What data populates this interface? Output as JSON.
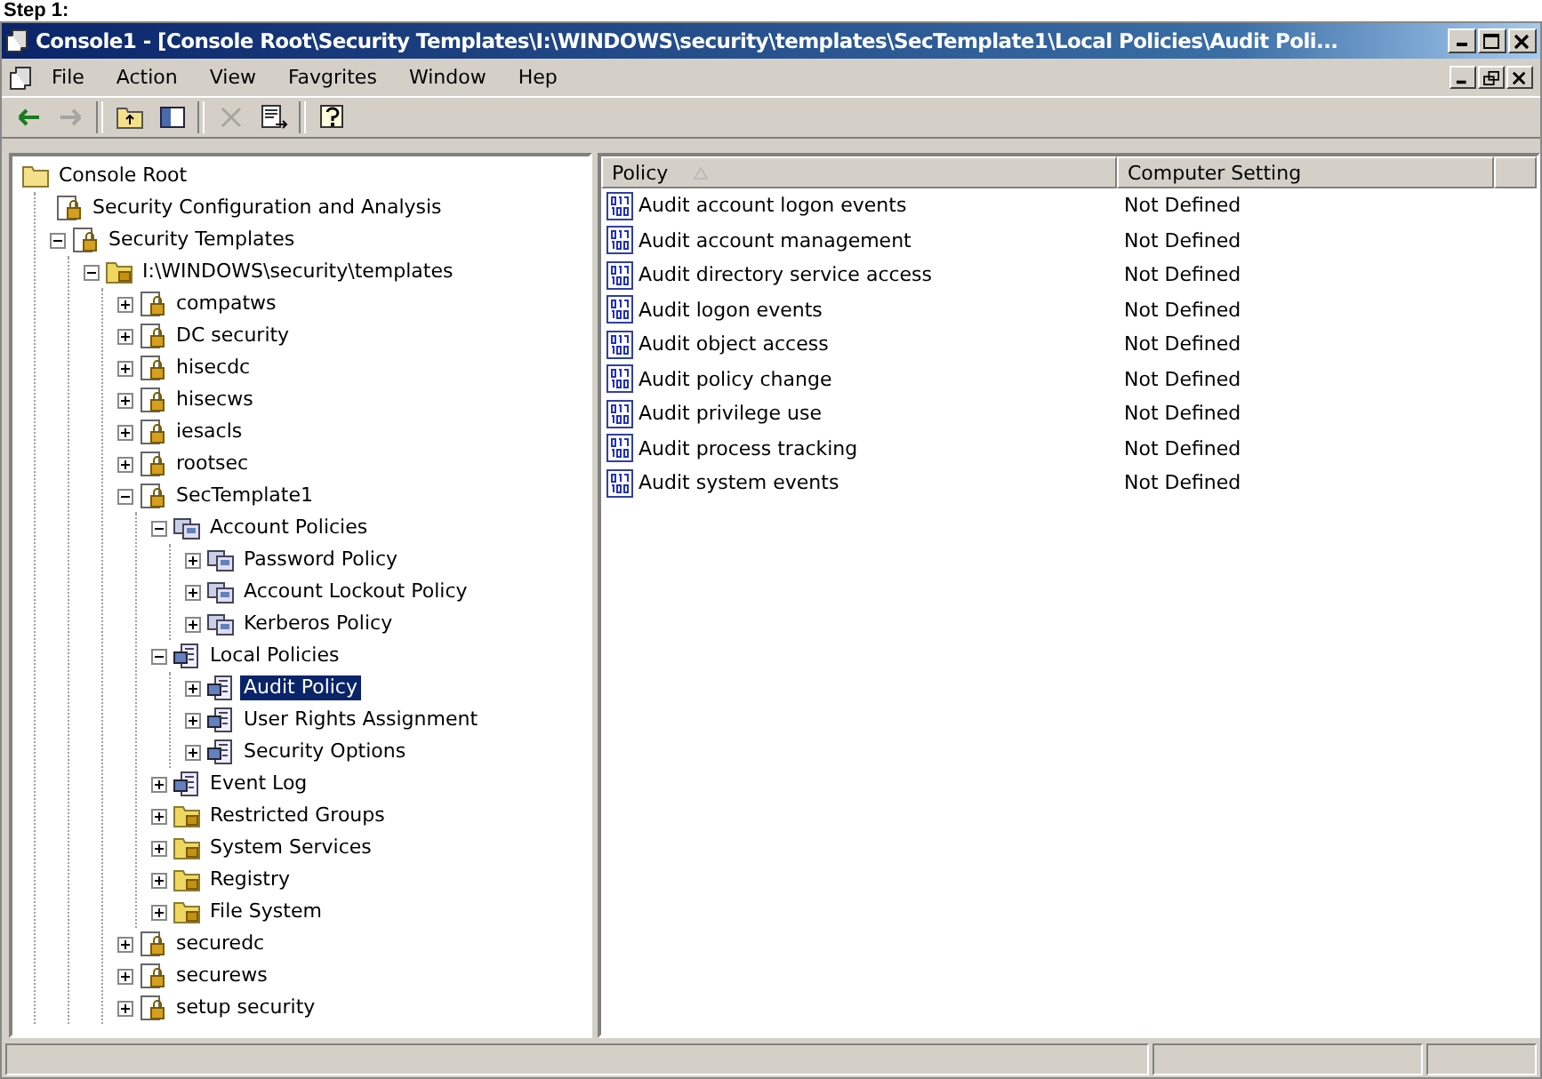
{
  "caption": "Step 1:",
  "window": {
    "title": "Console1 - [Console Root\\Security Templates\\I:\\WINDOWS\\security\\templates\\SecTemplate1\\Local Policies\\Audit Poli..."
  },
  "menu": [
    "File",
    "Action",
    "View",
    "Favgrites",
    "Window",
    "Hep"
  ],
  "toolbar": [
    {
      "kind": "back",
      "disabled": false
    },
    {
      "kind": "forward",
      "disabled": true
    },
    {
      "kind": "up",
      "disabled": false
    },
    {
      "kind": "tree",
      "disabled": false
    },
    {
      "kind": "delete",
      "disabled": true
    },
    {
      "kind": "export",
      "disabled": false
    },
    {
      "kind": "help",
      "disabled": false
    }
  ],
  "tree": [
    {
      "label": "Console Root",
      "kind": "folder",
      "selected": false,
      "children": [
        {
          "label": "Security Configuration and Analysis",
          "kind": "snapin",
          "selected": false
        },
        {
          "label": "Security Templates",
          "kind": "snapin",
          "selected": false,
          "expanded": true,
          "children": [
            {
              "label": "I:\\WINDOWS\\security\\templates",
              "kind": "store",
              "selected": false,
              "expanded": true,
              "children": [
                {
                  "label": "compatws",
                  "kind": "template",
                  "selected": false,
                  "expanded": false
                },
                {
                  "label": "DC security",
                  "kind": "template",
                  "selected": false,
                  "expanded": false
                },
                {
                  "label": "hisecdc",
                  "kind": "template",
                  "selected": false,
                  "expanded": false
                },
                {
                  "label": "hisecws",
                  "kind": "template",
                  "selected": false,
                  "expanded": false
                },
                {
                  "label": "iesacls",
                  "kind": "template",
                  "selected": false,
                  "expanded": false
                },
                {
                  "label": "rootsec",
                  "kind": "template",
                  "selected": false,
                  "expanded": false
                },
                {
                  "label": "SecTemplate1",
                  "kind": "template",
                  "selected": false,
                  "expanded": true,
                  "children": [
                    {
                      "label": "Account Policies",
                      "kind": "policy",
                      "selected": false,
                      "expanded": true,
                      "children": [
                        {
                          "label": "Password Policy",
                          "kind": "policy",
                          "selected": false,
                          "expanded": false
                        },
                        {
                          "label": "Account Lockout Policy",
                          "kind": "policy",
                          "selected": false,
                          "expanded": false
                        },
                        {
                          "label": "Kerberos Policy",
                          "kind": "policy",
                          "selected": false,
                          "expanded": false
                        }
                      ]
                    },
                    {
                      "label": "Local Policies",
                      "kind": "local",
                      "selected": false,
                      "expanded": true,
                      "children": [
                        {
                          "label": "Audit Policy",
                          "kind": "local",
                          "selected": true,
                          "expanded": false
                        },
                        {
                          "label": "User Rights Assignment",
                          "kind": "local",
                          "selected": false,
                          "expanded": false
                        },
                        {
                          "label": "Security Options",
                          "kind": "local",
                          "selected": false,
                          "expanded": false
                        }
                      ]
                    },
                    {
                      "label": "Event Log",
                      "kind": "local",
                      "selected": false,
                      "expanded": false
                    },
                    {
                      "label": "Restricted Groups",
                      "kind": "store",
                      "selected": false,
                      "expanded": false
                    },
                    {
                      "label": "System Services",
                      "kind": "store",
                      "selected": false,
                      "expanded": false
                    },
                    {
                      "label": "Registry",
                      "kind": "store",
                      "selected": false,
                      "expanded": false
                    },
                    {
                      "label": "File System",
                      "kind": "store",
                      "selected": false,
                      "expanded": false
                    }
                  ]
                },
                {
                  "label": "securedc",
                  "kind": "template",
                  "selected": false,
                  "expanded": false
                },
                {
                  "label": "securews",
                  "kind": "template",
                  "selected": false,
                  "expanded": false
                },
                {
                  "label": "setup security",
                  "kind": "template",
                  "selected": false,
                  "expanded": false
                }
              ]
            }
          ]
        }
      ]
    }
  ],
  "list": {
    "columns": [
      "Policy",
      "Computer Setting"
    ],
    "rows": [
      {
        "policy": "Audit account logon events",
        "setting": "Not Defined"
      },
      {
        "policy": "Audit account management",
        "setting": "Not Defined"
      },
      {
        "policy": "Audit directory service access",
        "setting": "Not Defined"
      },
      {
        "policy": "Audit logon events",
        "setting": "Not Defined"
      },
      {
        "policy": "Audit object access",
        "setting": "Not Defined"
      },
      {
        "policy": "Audit policy change",
        "setting": "Not Defined"
      },
      {
        "policy": "Audit privilege use",
        "setting": "Not Defined"
      },
      {
        "policy": "Audit process tracking",
        "setting": "Not Defined"
      },
      {
        "policy": "Audit system events",
        "setting": "Not Defined"
      }
    ]
  }
}
